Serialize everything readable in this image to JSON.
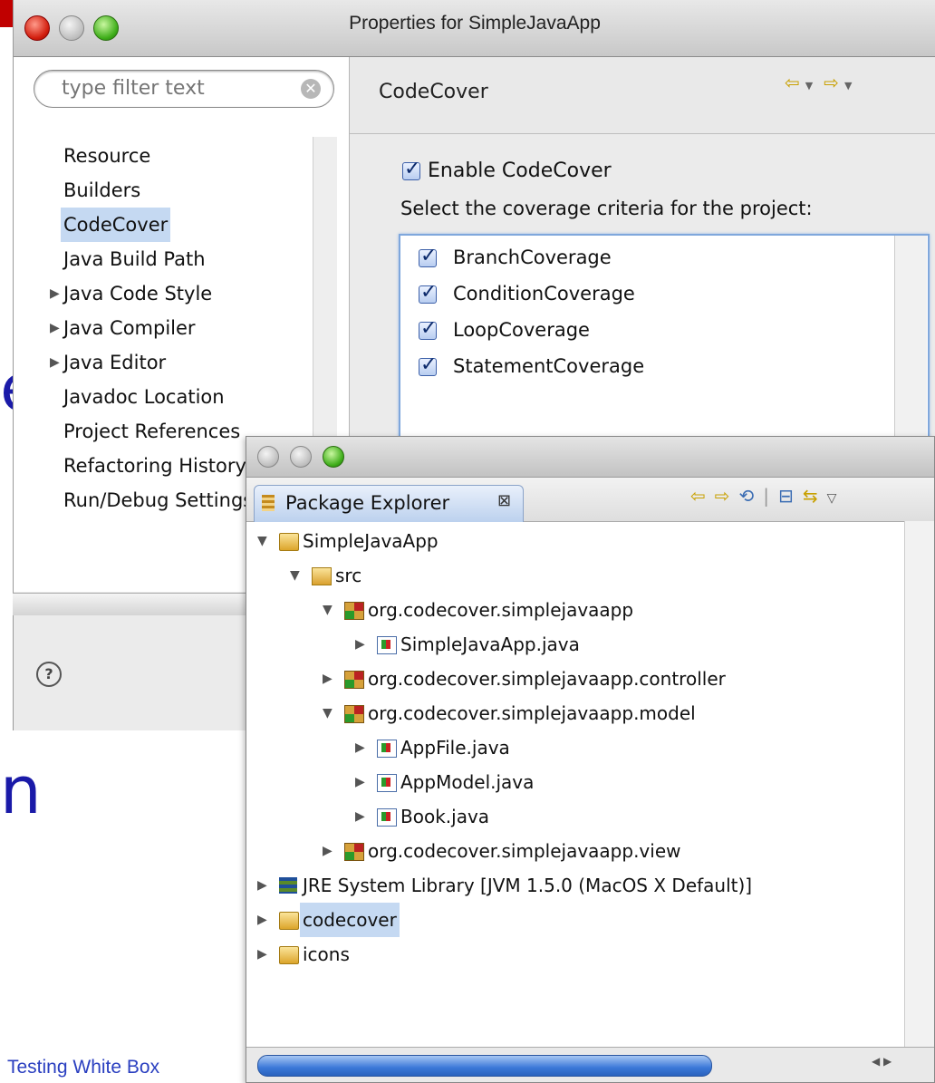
{
  "properties_dialog": {
    "title": "Properties for SimpleJavaApp",
    "filter_placeholder": "type filter text",
    "nav_items": [
      {
        "label": "Resource",
        "expandable": false
      },
      {
        "label": "Builders",
        "expandable": false
      },
      {
        "label": "CodeCover",
        "expandable": false,
        "selected": true
      },
      {
        "label": "Java Build Path",
        "expandable": false
      },
      {
        "label": "Java Code Style",
        "expandable": true
      },
      {
        "label": "Java Compiler",
        "expandable": true
      },
      {
        "label": "Java Editor",
        "expandable": true
      },
      {
        "label": "Javadoc Location",
        "expandable": false
      },
      {
        "label": "Project References",
        "expandable": false
      },
      {
        "label": "Refactoring History",
        "expandable": false
      },
      {
        "label": "Run/Debug Settings",
        "expandable": false
      }
    ],
    "page_title": "CodeCover",
    "enable_label": "Enable CodeCover",
    "enable_checked": true,
    "criteria_prompt": "Select the coverage criteria for the project:",
    "criteria": [
      {
        "label": "BranchCoverage",
        "checked": true
      },
      {
        "label": "ConditionCoverage",
        "checked": true
      },
      {
        "label": "LoopCoverage",
        "checked": true
      },
      {
        "label": "StatementCoverage",
        "checked": true
      }
    ],
    "help_icon": "question-circle-icon"
  },
  "package_explorer": {
    "tab_label": "Package Explorer",
    "tree": [
      {
        "label": "SimpleJavaApp",
        "icon": "project-folder-icon",
        "expanded": true
      },
      {
        "label": "src",
        "icon": "source-folder-icon",
        "expanded": true
      },
      {
        "label": "org.codecover.simplejavaapp",
        "icon": "package-icon",
        "expanded": true
      },
      {
        "label": "SimpleJavaApp.java",
        "icon": "java-file-icon",
        "expanded": false
      },
      {
        "label": "org.codecover.simplejavaapp.controller",
        "icon": "package-icon",
        "expanded": false
      },
      {
        "label": "org.codecover.simplejavaapp.model",
        "icon": "package-icon",
        "expanded": true
      },
      {
        "label": "AppFile.java",
        "icon": "java-file-icon",
        "expanded": false
      },
      {
        "label": "AppModel.java",
        "icon": "java-file-icon",
        "expanded": false
      },
      {
        "label": "Book.java",
        "icon": "java-file-icon",
        "expanded": false
      },
      {
        "label": "org.codecover.simplejavaapp.view",
        "icon": "package-icon",
        "expanded": false
      },
      {
        "label": "JRE System Library [JVM 1.5.0 (MacOS X Default)]",
        "icon": "library-icon",
        "expanded": false
      },
      {
        "label": "codecover",
        "icon": "folder-icon",
        "expanded": false,
        "selected": true
      },
      {
        "label": "icons",
        "icon": "folder-icon",
        "expanded": false
      }
    ]
  },
  "slide": {
    "footer_text": "Testing White Box",
    "fragment_e": "e",
    "fragment_n": "n"
  },
  "colors": {
    "selection": "#c5d9f2",
    "slide_text": "#1a1aa8",
    "slide_footer": "#2a3fc0",
    "slide_accent": "#c00000"
  }
}
